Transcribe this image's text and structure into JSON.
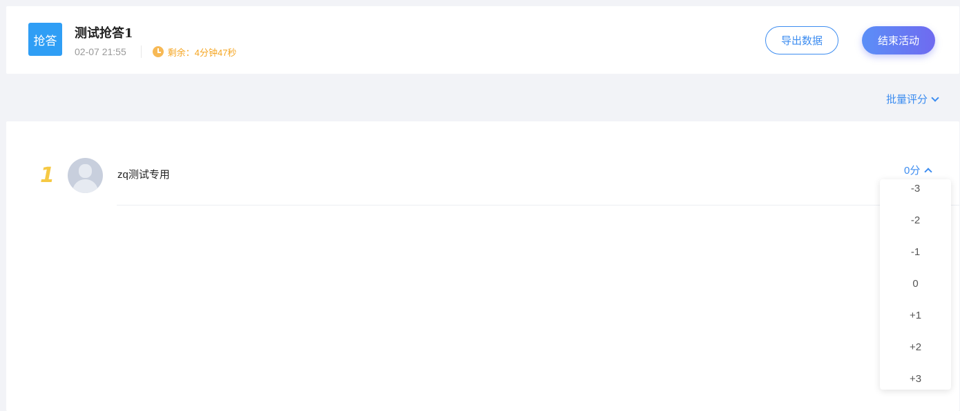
{
  "header": {
    "type_badge": "抢答",
    "title": "测试抢答1",
    "date": "02-07 21:55",
    "remaining": "剩余：4分钟47秒",
    "export_label": "导出数据",
    "end_label": "结束活动"
  },
  "toolbar": {
    "batch_score_label": "批量评分"
  },
  "list": {
    "rows": [
      {
        "rank": "1",
        "username": "zq测试专用",
        "score": "0分"
      }
    ]
  },
  "score_dropdown": {
    "options": [
      "-3",
      "-2",
      "-1",
      "0",
      "+1",
      "+2",
      "+3"
    ]
  },
  "colors": {
    "accent": "#3c8cf0",
    "badge": "#2f9ef5",
    "warning": "#f5a623",
    "rank_gold": "#f6c944"
  }
}
